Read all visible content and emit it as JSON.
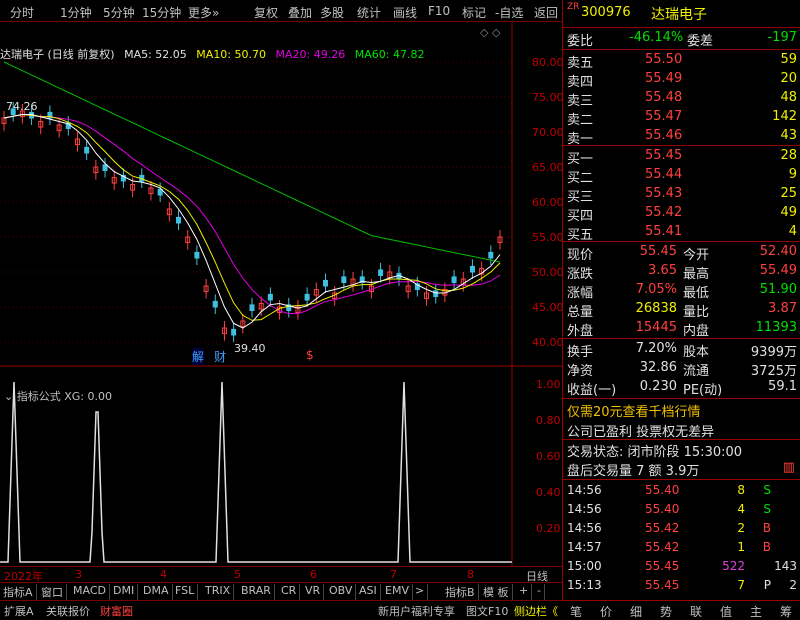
{
  "toolbar": {
    "items": [
      "分时",
      "1分钟",
      "5分钟",
      "15分钟",
      "更多»",
      "复权",
      "叠加",
      "多股",
      "统计",
      "画线",
      "F10",
      "标记",
      "-自选",
      "返回"
    ]
  },
  "chart": {
    "title": "达瑞电子 (日线 前复权)",
    "ma5": "MA5: 52.05",
    "ma10": "MA10: 50.70",
    "ma20": "MA20: 49.26",
    "ma60": "MA60: 47.82",
    "high_label": "74.26",
    "low_label": "39.40",
    "marker_jie": "解",
    "marker_cai": "财",
    "marker_s": "$",
    "yticks": [
      "80.00",
      "75.00",
      "70.00",
      "65.00",
      "60.00",
      "55.00",
      "50.00",
      "45.00",
      "40.00"
    ],
    "indicator_title": "指标公式 XG: 0.00",
    "ind_yticks": [
      "1.00",
      "0.80",
      "0.60",
      "0.40",
      "0.20"
    ],
    "dates": [
      "2022年",
      "3",
      "4",
      "5",
      "6",
      "7",
      "8"
    ],
    "period_label": "日线"
  },
  "ind_tabs": [
    "指标A",
    "窗口",
    "MACD",
    "DMI",
    "DMA",
    "FSL",
    "TRIX",
    "BRAR",
    "CR",
    "VR",
    "OBV",
    "ASI",
    "EMV",
    ">",
    "指标B",
    "模 板",
    "+",
    "-"
  ],
  "bottom": {
    "left": [
      "扩展A",
      "关联报价",
      "财富圈"
    ],
    "promo": "新用户福利专享",
    "f10": "图文F10",
    "sidebar": "侧边栏《"
  },
  "quote": {
    "code": "300976",
    "name": "达瑞电子",
    "weibi_label": "委比",
    "weibi": "-46.14%",
    "weicha_label": "委差",
    "weicha": "-197",
    "asks": [
      {
        "label": "卖五",
        "price": "55.50",
        "vol": "59"
      },
      {
        "label": "卖四",
        "price": "55.49",
        "vol": "20"
      },
      {
        "label": "卖三",
        "price": "55.48",
        "vol": "48"
      },
      {
        "label": "卖二",
        "price": "55.47",
        "vol": "142"
      },
      {
        "label": "卖一",
        "price": "55.46",
        "vol": "43"
      }
    ],
    "bids": [
      {
        "label": "买一",
        "price": "55.45",
        "vol": "28"
      },
      {
        "label": "买二",
        "price": "55.44",
        "vol": "9"
      },
      {
        "label": "买三",
        "price": "55.43",
        "vol": "25"
      },
      {
        "label": "买四",
        "price": "55.42",
        "vol": "49"
      },
      {
        "label": "买五",
        "price": "55.41",
        "vol": "4"
      }
    ],
    "stats": [
      [
        "现价",
        "55.45",
        "今开",
        "52.40"
      ],
      [
        "涨跌",
        "3.65",
        "最高",
        "55.49"
      ],
      [
        "涨幅",
        "7.05%",
        "最低",
        "51.90"
      ],
      [
        "总量",
        "26838",
        "量比",
        "3.87"
      ],
      [
        "外盘",
        "15445",
        "内盘",
        "11393"
      ]
    ],
    "stats2": [
      [
        "换手",
        "7.20%",
        "股本",
        "9399万"
      ],
      [
        "净资",
        "32.86",
        "流通",
        "3725万"
      ],
      [
        "收益(一)",
        "0.230",
        "PE(动)",
        "59.1"
      ]
    ],
    "promo1": "仅需20元查看千档行情",
    "promo2": "公司已盈利 投票权无差异",
    "status": "交易状态: 闭市阶段 15:30:00",
    "after": "盘后交易量 7 额 3.9万",
    "ticks": [
      [
        "14:56",
        "55.40",
        "8",
        "S"
      ],
      [
        "14:56",
        "55.40",
        "4",
        "S"
      ],
      [
        "14:56",
        "55.42",
        "2",
        "B"
      ],
      [
        "14:57",
        "55.42",
        "1",
        "B"
      ],
      [
        "15:00",
        "55.45",
        "522",
        "143"
      ],
      [
        "15:13",
        "55.45",
        "7",
        "P",
        "2"
      ]
    ]
  },
  "right_tabs": [
    "笔",
    "价",
    "细",
    "势",
    "联",
    "值",
    "主",
    "筹"
  ]
}
